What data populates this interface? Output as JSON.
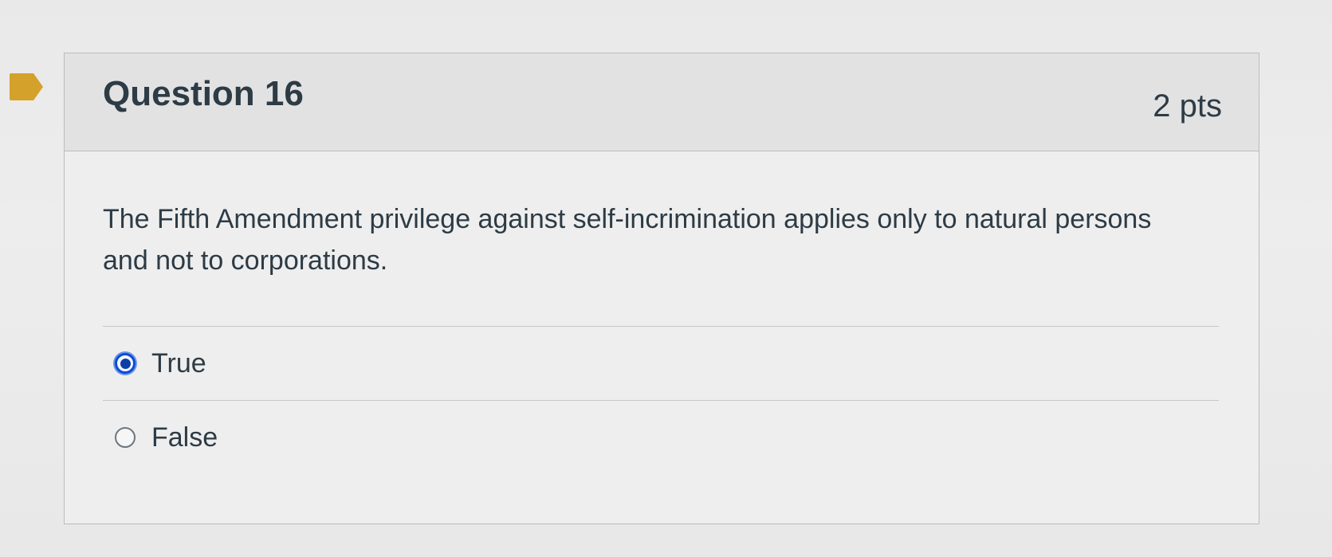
{
  "question": {
    "title": "Question 16",
    "points": "2 pts",
    "text": "The Fifth Amendment privilege against self-incrimination applies only to natural persons and not to corporations.",
    "flag_icon": "flag-icon",
    "flag_color": "#d4a12a",
    "answers": [
      {
        "label": "True",
        "selected": true
      },
      {
        "label": "False",
        "selected": false
      }
    ],
    "selected_color": "#0b4cd6"
  }
}
